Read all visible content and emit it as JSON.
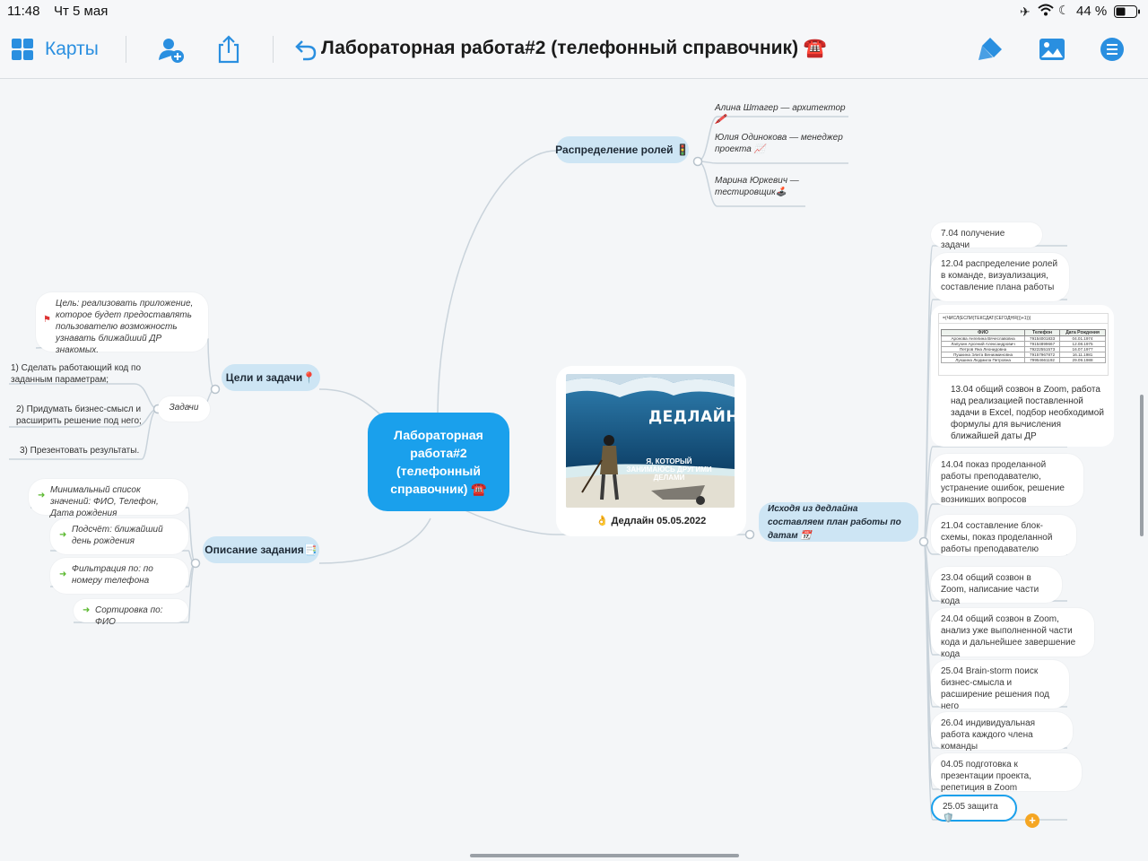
{
  "status": {
    "time": "11:48",
    "date": "Чт 5 мая",
    "battery": "44 %"
  },
  "toolbar": {
    "maps_label": "Карты",
    "title": "Лабораторная работа#2 (телефонный справочник) ☎️"
  },
  "mindmap": {
    "root": {
      "label": "Лабораторная работа#2 (телефонный справочник) ☎️"
    },
    "roles": {
      "label": "Распределение ролей 🚦",
      "items": [
        "Алина Штагер — архитектор🖍️",
        "Юлия Одинокова — менеджер проекта 📈",
        "Марина Юркевич — тестировщик🕹️"
      ]
    },
    "goals": {
      "label": "Цели и задачи📍",
      "goal": "Цель: реализовать приложение, которое будет предоставлять пользователю возможность узнавать ближайший ДР знакомых.",
      "tasks_label": "Задачи",
      "tasks": [
        "1) Сделать работающий код по заданным параметрам;",
        "2) Придумать бизнес-смысл и расширить решение под него;",
        "3) Презентовать результаты."
      ]
    },
    "description": {
      "label": "Описание задания📑",
      "items": [
        "Минимальный список значений: ФИО, Телефон, Дата рождения",
        "Подсчёт: ближайший день рождения",
        "Фильтрация по: по номеру телефона",
        "Сортировка по: ФИО"
      ]
    },
    "deadline": {
      "caption": "👌 Дедлайн 05.05.2022",
      "meme_top": "ДЕДЛАЙН",
      "meme_bottom": "Я, КОТОРЫЙ ЗАНИМАЮСЬ ДРУГИМИ ДЕЛАМИ"
    },
    "plan": {
      "label": "Исходя из дедлайна составляем план работы по датам 📆",
      "items": [
        "7.04 получение задачи",
        "12.04 распределение ролей в команде, визуализация, составление плана работы",
        "13.04 общий созвон в Zoom, работа над реализацией поставленной задачи в Excel, подбор необходимой формулы для вычисления ближайшей даты ДР",
        "14.04 показ проделанной работы преподавателю, устранение ошибок, решение возникших вопросов",
        "21.04 составление блок-схемы, показ проделанной работы преподавателю",
        "23.04 общий созвон в Zoom, написание части кода",
        "24.04 общий созвон в Zoom, анализ уже выполненной части кода и дальнейшее завершение кода",
        "25.04 Brain-storm поиск бизнес-смысла и расширение решения под него",
        "26.04 индивидуальная работа каждого члена команды",
        "04.05 подготовка к презентации проекта, репетиция в Zoom",
        "25.05 защита🛡️"
      ]
    },
    "sheet": {
      "formula": "=(ЧИСЛ(ЕСЛИ(ТЕКСДАТ(СЕГОДНЯ())+1)))",
      "headers": [
        "ФИО",
        "Телефон",
        "Дата Рождения"
      ],
      "rows": [
        [
          "Аронова Ангелина Вячеславовна",
          "79154001833",
          "04.01.1974"
        ],
        [
          "Лапухин Арсений Александрович",
          "79154899667",
          "12.08.1975"
        ],
        [
          "Петров Яна Леонидовна",
          "79222551573",
          "16.07.1977"
        ],
        [
          "Пушкина Элита Вениаминовна",
          "79157967872",
          "16.11.1981"
        ],
        [
          "Лукшина Людмила Петровна",
          "79954661192",
          "29.09.1988"
        ]
      ]
    }
  },
  "colors": {
    "accent": "#1aa0ec",
    "pill": "#cde5f4",
    "link": "#c9d3db",
    "background": "#f4f6f8"
  }
}
